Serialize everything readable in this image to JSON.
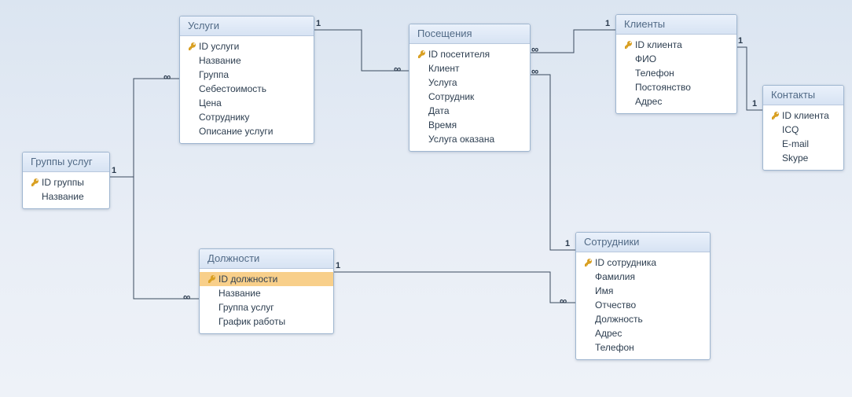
{
  "entities": {
    "groups": {
      "title": "Группы услуг",
      "fields": [
        {
          "n": "ID группы",
          "k": true
        },
        {
          "n": "Название"
        }
      ]
    },
    "services": {
      "title": "Услуги",
      "fields": [
        {
          "n": "ID услуги",
          "k": true
        },
        {
          "n": "Название"
        },
        {
          "n": "Группа"
        },
        {
          "n": "Себестоимость"
        },
        {
          "n": "Цена"
        },
        {
          "n": "Сотруднику"
        },
        {
          "n": "Описание услуги"
        }
      ]
    },
    "visits": {
      "title": "Посещения",
      "fields": [
        {
          "n": "ID посетителя",
          "k": true
        },
        {
          "n": "Клиент"
        },
        {
          "n": "Услуга"
        },
        {
          "n": "Сотрудник"
        },
        {
          "n": "Дата"
        },
        {
          "n": "Время"
        },
        {
          "n": "Услуга оказана"
        }
      ]
    },
    "clients": {
      "title": "Клиенты",
      "fields": [
        {
          "n": "ID клиента",
          "k": true
        },
        {
          "n": "ФИО"
        },
        {
          "n": "Телефон"
        },
        {
          "n": "Постоянство"
        },
        {
          "n": "Адрес"
        }
      ]
    },
    "contacts": {
      "title": "Контакты",
      "fields": [
        {
          "n": "ID клиента",
          "k": true
        },
        {
          "n": "ICQ"
        },
        {
          "n": "E-mail"
        },
        {
          "n": "Skype"
        }
      ]
    },
    "positions": {
      "title": "Должности",
      "fields": [
        {
          "n": "ID должности",
          "k": true,
          "sel": true
        },
        {
          "n": "Название"
        },
        {
          "n": "Группа услуг"
        },
        {
          "n": "График работы"
        }
      ]
    },
    "employees": {
      "title": "Сотрудники",
      "fields": [
        {
          "n": "ID сотрудника",
          "k": true
        },
        {
          "n": "Фамилия"
        },
        {
          "n": "Имя"
        },
        {
          "n": "Отчество"
        },
        {
          "n": "Должность"
        },
        {
          "n": "Адрес"
        },
        {
          "n": "Телефон"
        }
      ]
    }
  },
  "rel_symbols": {
    "one": "1",
    "many": "∞"
  },
  "relationships": [
    {
      "from": "groups",
      "to": "services",
      "card_from": "1",
      "card_to": "∞"
    },
    {
      "from": "groups",
      "to": "positions",
      "card_from": "1",
      "card_to": "∞"
    },
    {
      "from": "services",
      "to": "visits",
      "card_from": "1",
      "card_to": "∞"
    },
    {
      "from": "clients",
      "to": "visits",
      "card_from": "1",
      "card_to": "∞"
    },
    {
      "from": "clients",
      "to": "contacts",
      "card_from": "1",
      "card_to": "1"
    },
    {
      "from": "positions",
      "to": "employees",
      "card_from": "1",
      "card_to": "∞"
    },
    {
      "from": "employees",
      "to": "visits",
      "card_from": "1",
      "card_to": "∞"
    }
  ]
}
